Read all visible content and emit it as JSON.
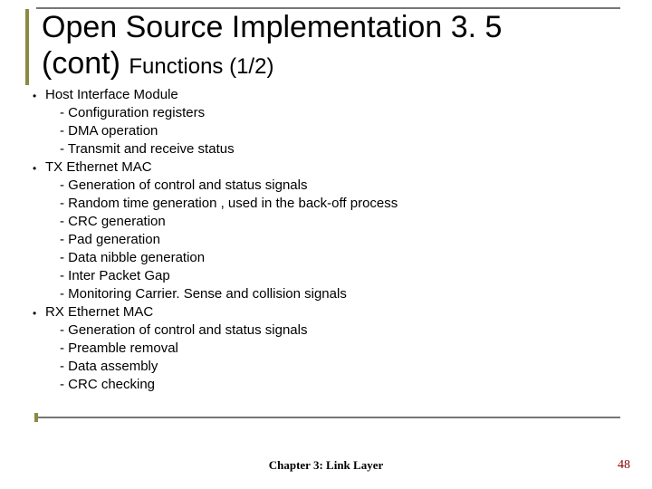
{
  "title": {
    "line1": "Open Source Implementation 3. 5",
    "line2_main": "(cont)",
    "line2_sub": "Functions (1/2)"
  },
  "body": {
    "sections": [
      {
        "heading": "Host Interface Module",
        "items": [
          "- Configuration registers",
          "- DMA operation",
          "- Transmit and receive status"
        ]
      },
      {
        "heading": "TX Ethernet MAC",
        "items": [
          "- Generation of control and status signals",
          "- Random time generation , used in the back-off process",
          "- CRC generation",
          "- Pad generation",
          "- Data nibble generation",
          "- Inter Packet Gap",
          "- Monitoring Carrier. Sense and collision signals"
        ]
      },
      {
        "heading": "RX Ethernet MAC",
        "items": [
          "- Generation of control and status signals",
          "- Preamble removal",
          "- Data assembly",
          "- CRC checking"
        ]
      }
    ]
  },
  "footer": {
    "center": "Chapter 3: Link Layer",
    "page": "48"
  }
}
